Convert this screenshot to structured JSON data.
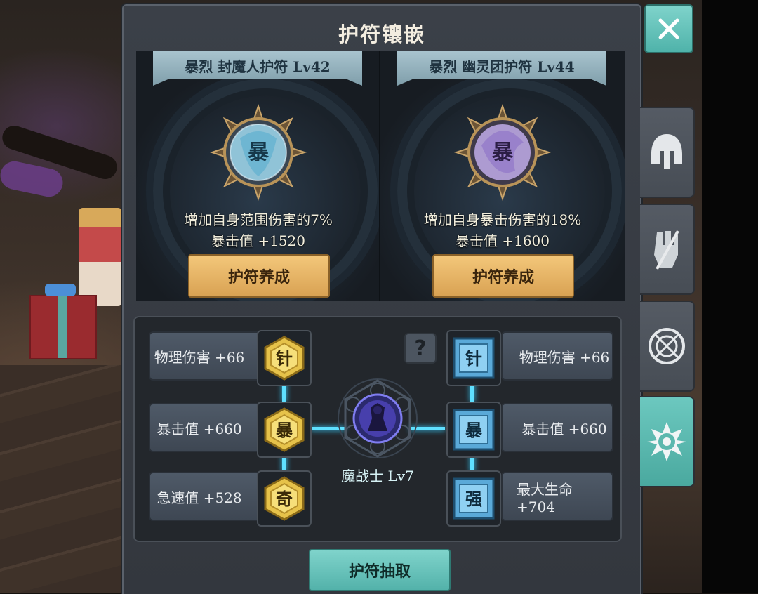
{
  "title": "护符镶嵌",
  "close_icon": "close-icon",
  "side_tabs": [
    {
      "icon": "helmet-icon",
      "active": false
    },
    {
      "icon": "gloves-icon",
      "active": false
    },
    {
      "icon": "target-icon",
      "active": false
    },
    {
      "icon": "amulet-icon",
      "active": true
    }
  ],
  "amulets": [
    {
      "name": "暴烈 封魔人护符 Lv42",
      "glyph": "暴",
      "effect": "增加自身范围伤害的7%",
      "stat": "暴击值 +1520",
      "button": "护符养成",
      "gem_color": "#9ad0e6"
    },
    {
      "name": "暴烈 幽灵团护符 Lv44",
      "glyph": "暴",
      "effect": "增加自身暴击伤害的18%",
      "stat": "暴击值 +1600",
      "button": "护符养成",
      "gem_color": "#b9a6e0"
    }
  ],
  "left_stats": [
    {
      "label": "物理伤害 +66",
      "glyph": "针"
    },
    {
      "label": "暴击值 +660",
      "glyph": "暴"
    },
    {
      "label": "急速值 +528",
      "glyph": "奇"
    }
  ],
  "right_stats": [
    {
      "label": "物理伤害 +66",
      "glyph": "针"
    },
    {
      "label": "暴击值 +660",
      "glyph": "暴"
    },
    {
      "label": "最大生命 +704",
      "glyph": "强"
    }
  ],
  "hero": {
    "label": "魔战士 Lv7"
  },
  "help_glyph": "?",
  "extract_button": "护符抽取",
  "colors": {
    "accent_teal": "#6cc8bf",
    "gold": "#e6c24a",
    "blue_socket": "#5aa9d8",
    "link": "#5fe0ff"
  }
}
